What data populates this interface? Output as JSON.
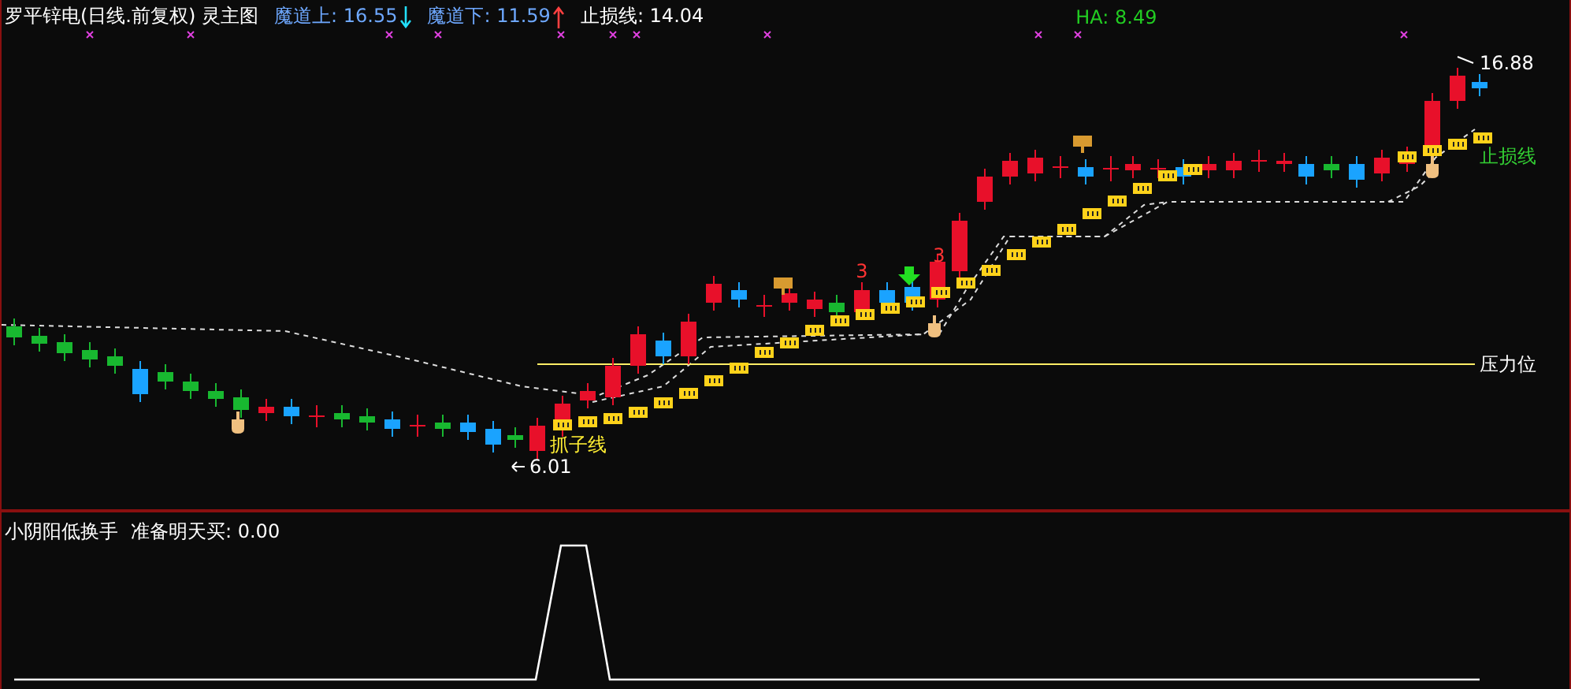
{
  "header": {
    "title": "罗平锌电(日线.前复权) 灵主图",
    "items": [
      {
        "label": "魔道上: 16.55",
        "kind": "upper"
      },
      {
        "label": "魔道下: 11.59",
        "kind": "lower"
      },
      {
        "label": "止损线: 14.04",
        "kind": "plain"
      },
      {
        "label": "HA: 8.49",
        "kind": "ha"
      }
    ]
  },
  "annotations": [
    {
      "text": "16.88",
      "kind": "high"
    },
    {
      "text": "止损线",
      "kind": "stop"
    },
    {
      "text": "压力位",
      "kind": "pressure"
    },
    {
      "text": "抓子线",
      "kind": "catch"
    },
    {
      "text": "6.01",
      "kind": "low"
    },
    {
      "text": "3",
      "kind": "count"
    },
    {
      "text": "3",
      "kind": "count"
    }
  ],
  "indicator": {
    "title": "小阴阳低换手",
    "reading": "准备明天买: 0.00"
  }
}
